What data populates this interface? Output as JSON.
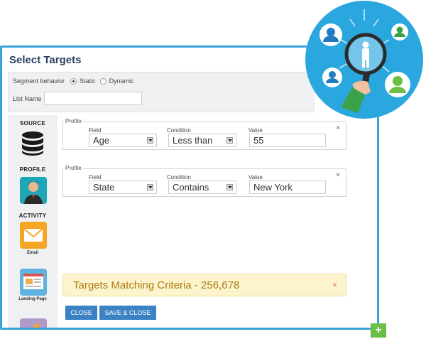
{
  "window": {
    "title": "Select Targets",
    "segment_label": "Segment behavior",
    "segment_options": [
      {
        "label": "Static",
        "selected": true
      },
      {
        "label": "Dynamic",
        "selected": false
      }
    ],
    "list_name_label": "List Name",
    "list_name_value": ""
  },
  "sidebar": {
    "sections": [
      {
        "heading": "SOURCE",
        "icon": "database-icon"
      },
      {
        "heading": "PROFILE",
        "icon": "person-icon"
      },
      {
        "heading": "ACTIVITY",
        "items": [
          {
            "label": "Email",
            "icon": "envelope-icon"
          },
          {
            "label": "Landing Page",
            "icon": "landing-page-icon"
          }
        ]
      }
    ]
  },
  "filters": [
    {
      "legend": "Profile",
      "field_label": "Field",
      "field": "Age",
      "condition_label": "Condition",
      "condition": "Less than",
      "value_label": "Value",
      "value": "55"
    },
    {
      "legend": "Profile",
      "field_label": "Field",
      "field": "State",
      "condition_label": "Condition",
      "condition": "Contains",
      "value_label": "Value",
      "value": "New York"
    }
  ],
  "results": {
    "text": "Targets Matching Criteria - 256,678",
    "close": "×"
  },
  "buttons": {
    "close": "CLOSE",
    "save_close": "SAVE & CLOSE"
  },
  "close_glyph": "×",
  "plus_glyph": "+",
  "colors": {
    "accent": "#3aa3d9",
    "button": "#3b82c4",
    "banner_bg": "#fcf4cc",
    "banner_text": "#b07a14",
    "plus": "#6cbe45"
  }
}
